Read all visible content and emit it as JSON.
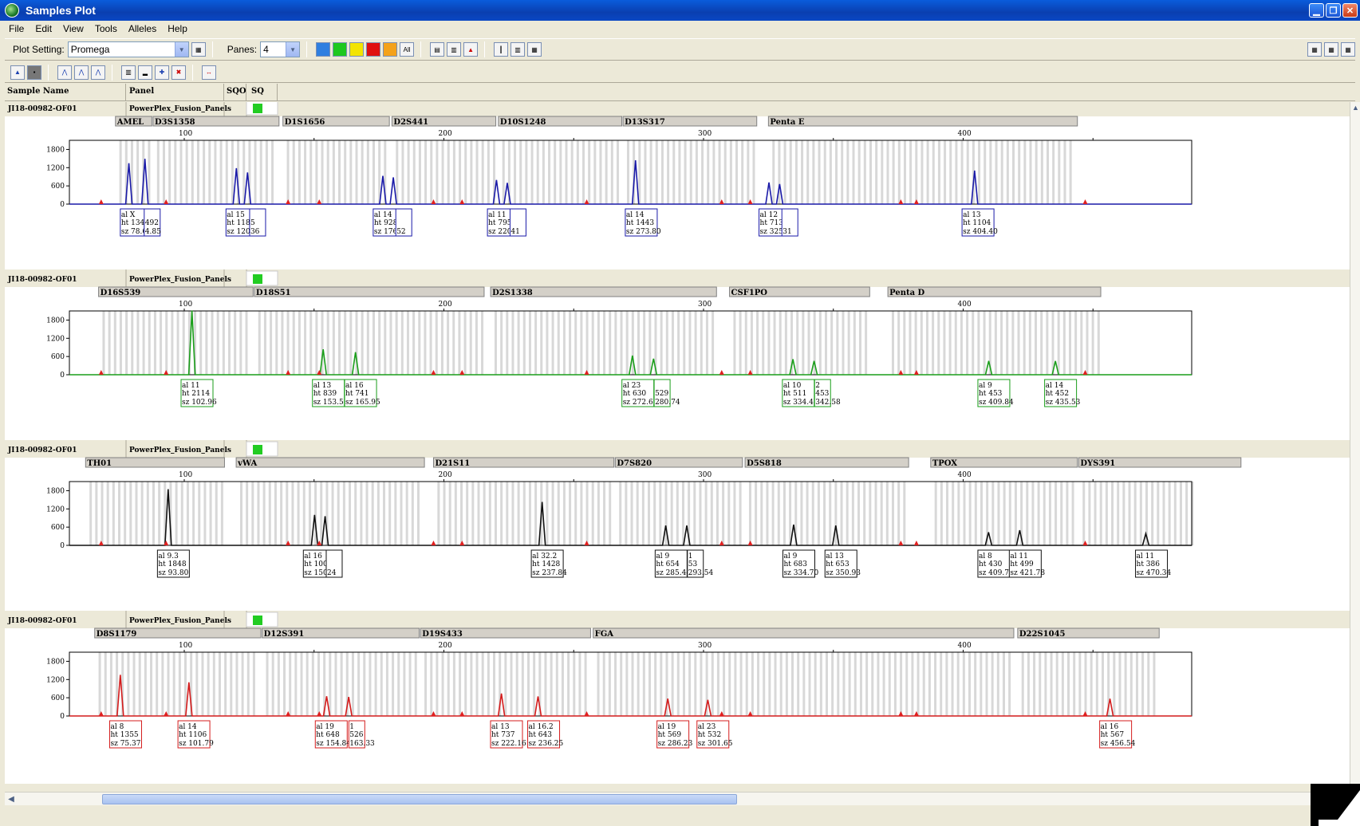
{
  "window": {
    "title": "Samples Plot"
  },
  "menu": [
    "File",
    "Edit",
    "View",
    "Tools",
    "Alleles",
    "Help"
  ],
  "toolbar": {
    "plot_setting_label": "Plot Setting:",
    "plot_setting_value": "Promega",
    "panes_label": "Panes:",
    "panes_value": "4",
    "color_buttons": [
      "#2f7fe0",
      "#1ec81e",
      "#f3e400",
      "#e01010",
      "#f4a21a"
    ],
    "all_label": "All"
  },
  "columns": {
    "sample_name": "Sample Name",
    "panel": "Panel",
    "sqo": "SQO",
    "sq": "SQ"
  },
  "x_ticks": [
    100,
    200,
    300,
    400
  ],
  "y_ticks": [
    0,
    600,
    1200,
    1800
  ],
  "panes": [
    {
      "sample": "JI18-00982-OF01",
      "panel": "PowerPlex_Fusion_Panels",
      "sq_color": "#22cc22",
      "color": "#1a1aa8",
      "loci": [
        {
          "name": "AMEL",
          "start": 73.5,
          "end": 87.5
        },
        {
          "name": "D3S1358",
          "start": 88,
          "end": 136.5
        },
        {
          "name": "D1S1656",
          "start": 138,
          "end": 179
        },
        {
          "name": "D2S441",
          "start": 180,
          "end": 220
        },
        {
          "name": "D10S1248",
          "start": 221,
          "end": 268.5
        },
        {
          "name": "D13S317",
          "start": 269,
          "end": 320.5
        },
        {
          "name": "Penta E",
          "start": 325,
          "end": 444
        }
      ],
      "peaks": [
        {
          "x": 78.67,
          "ht": 1348
        },
        {
          "x": 84.85,
          "ht": 1492
        },
        {
          "x": 120.07,
          "ht": 1182
        },
        {
          "x": 124.36,
          "ht": 1040
        },
        {
          "x": 176.49,
          "ht": 928
        },
        {
          "x": 180.52,
          "ht": 880
        },
        {
          "x": 220.25,
          "ht": 795
        },
        {
          "x": 224.41,
          "ht": 700
        },
        {
          "x": 273.8,
          "ht": 1443
        },
        {
          "x": 325.2,
          "ht": 713
        },
        {
          "x": 329.31,
          "ht": 660
        },
        {
          "x": 404.4,
          "ht": 1104
        }
      ],
      "labels": [
        {
          "x": 80.9,
          "al": "al X",
          "ht": "ht 1348",
          "sz": "sz 78.67"
        },
        {
          "x": 85.5,
          "al": "",
          "ht": "492",
          "sz": "4.85",
          "narrow": true
        },
        {
          "x": 121.6,
          "al": "al 15",
          "ht": "ht 1182",
          "sz": "sz 120.07"
        },
        {
          "x": 126.1,
          "al": "",
          "ht": "5",
          "sz": "36",
          "narrow": true
        },
        {
          "x": 178.3,
          "al": "al 14",
          "ht": "ht 928",
          "sz": "sz 176.49"
        },
        {
          "x": 182.4,
          "al": "",
          "ht": "",
          "sz": "52",
          "narrow": true
        },
        {
          "x": 222.3,
          "al": "al 11",
          "ht": "ht 795",
          "sz": "sz 220.25"
        },
        {
          "x": 226.4,
          "al": "",
          "ht": "",
          "sz": "41",
          "narrow": true
        },
        {
          "x": 275.4,
          "al": "al 14",
          "ht": "ht 1443",
          "sz": "sz 273.80"
        },
        {
          "x": 326.9,
          "al": "al 12",
          "ht": "ht 713",
          "sz": "sz 325.20"
        },
        {
          "x": 331.1,
          "al": "",
          "ht": "",
          "sz": "31",
          "narrow": true
        },
        {
          "x": 405.1,
          "al": "al 13",
          "ht": "ht 1104",
          "sz": "sz 404.40"
        }
      ]
    },
    {
      "sample": "JI18-00982-OF01",
      "panel": "PowerPlex_Fusion_Panels",
      "sq_color": "#22cc22",
      "color": "#1a9e1a",
      "loci": [
        {
          "name": "D16S539",
          "start": 67,
          "end": 126.5
        },
        {
          "name": "D18S51",
          "start": 127,
          "end": 215.5
        },
        {
          "name": "D2S1338",
          "start": 218,
          "end": 305
        },
        {
          "name": "CSF1PO",
          "start": 310,
          "end": 364
        },
        {
          "name": "Penta D",
          "start": 371,
          "end": 453
        }
      ],
      "peaks": [
        {
          "x": 102.96,
          "ht": 2114
        },
        {
          "x": 153.51,
          "ht": 839
        },
        {
          "x": 165.95,
          "ht": 741
        },
        {
          "x": 272.61,
          "ht": 630
        },
        {
          "x": 280.74,
          "ht": 529
        },
        {
          "x": 334.43,
          "ht": 511
        },
        {
          "x": 342.58,
          "ht": 453
        },
        {
          "x": 409.84,
          "ht": 453
        },
        {
          "x": 435.53,
          "ht": 452
        }
      ],
      "labels": [
        {
          "x": 104.3,
          "al": "al 11",
          "ht": "ht 2114",
          "sz": "sz 102.96"
        },
        {
          "x": 154.9,
          "al": "al 13",
          "ht": "ht 839",
          "sz": "sz 153.51"
        },
        {
          "x": 167.3,
          "al": "al 16",
          "ht": "ht 741",
          "sz": "sz 165.95"
        },
        {
          "x": 274.1,
          "al": "al 23",
          "ht": "ht 630",
          "sz": "sz 272.61"
        },
        {
          "x": 281.9,
          "al": "",
          "ht": "529",
          "sz": "280.74",
          "narrow": true
        },
        {
          "x": 335.9,
          "al": "al 10",
          "ht": "ht 511",
          "sz": "sz 334.43"
        },
        {
          "x": 343.7,
          "al": "2",
          "ht": "453",
          "sz": "342.58",
          "narrow": true
        },
        {
          "x": 411.2,
          "al": "al 9",
          "ht": "ht 453",
          "sz": "sz 409.84"
        },
        {
          "x": 436.9,
          "al": "al 14",
          "ht": "ht 452",
          "sz": "sz 435.53"
        }
      ]
    },
    {
      "sample": "JI18-00982-OF01",
      "panel": "PowerPlex_Fusion_Panels",
      "sq_color": "#22cc22",
      "color": "#101010",
      "loci": [
        {
          "name": "TH01",
          "start": 62,
          "end": 115.5
        },
        {
          "name": "vWA",
          "start": 120,
          "end": 192.5
        },
        {
          "name": "D21S11",
          "start": 196,
          "end": 265.5
        },
        {
          "name": "D7S820",
          "start": 266,
          "end": 315
        },
        {
          "name": "D5S818",
          "start": 316,
          "end": 379
        },
        {
          "name": "TPOX",
          "start": 387.5,
          "end": 444
        },
        {
          "name": "DYS391",
          "start": 444.5,
          "end": 507
        }
      ],
      "peaks": [
        {
          "x": 93.8,
          "ht": 1848
        },
        {
          "x": 150.19,
          "ht": 1003
        },
        {
          "x": 154.24,
          "ht": 960
        },
        {
          "x": 237.84,
          "ht": 1428
        },
        {
          "x": 285.44,
          "ht": 654
        },
        {
          "x": 293.54,
          "ht": 653
        },
        {
          "x": 334.7,
          "ht": 683
        },
        {
          "x": 350.93,
          "ht": 653
        },
        {
          "x": 409.77,
          "ht": 430
        },
        {
          "x": 421.78,
          "ht": 499
        },
        {
          "x": 470.34,
          "ht": 386
        }
      ],
      "labels": [
        {
          "x": 95.2,
          "al": "al 9.3",
          "ht": "ht 1848",
          "sz": "sz 93.80"
        },
        {
          "x": 151.4,
          "al": "al 16",
          "ht": "ht 1003",
          "sz": "sz 150.19"
        },
        {
          "x": 155.6,
          "al": "",
          "ht": "",
          "sz": "24",
          "narrow": true
        },
        {
          "x": 239.2,
          "al": "al 32.2",
          "ht": "ht 1428",
          "sz": "sz 237.84"
        },
        {
          "x": 286.9,
          "al": "al 9",
          "ht": "ht 654",
          "sz": "sz 285.44"
        },
        {
          "x": 294.7,
          "al": "1",
          "ht": "53",
          "sz": "293.54",
          "narrow": true
        },
        {
          "x": 336.1,
          "al": "al 9",
          "ht": "ht 683",
          "sz": "sz 334.70"
        },
        {
          "x": 352.3,
          "al": "al 13",
          "ht": "ht 653",
          "sz": "sz 350.93"
        },
        {
          "x": 411.2,
          "al": "al 8",
          "ht": "ht 430",
          "sz": "sz 409.77"
        },
        {
          "x": 423.3,
          "al": "al 11",
          "ht": "ht 499",
          "sz": "sz 421.78"
        },
        {
          "x": 471.9,
          "al": "al 11",
          "ht": "ht 386",
          "sz": "sz 470.34"
        }
      ]
    },
    {
      "sample": "JI18-00982-OF01",
      "panel": "PowerPlex_Fusion_Panels",
      "sq_color": "#22cc22",
      "color": "#d41c1c",
      "loci": [
        {
          "name": "D8S1179",
          "start": 65.5,
          "end": 129.5
        },
        {
          "name": "D12S391",
          "start": 130,
          "end": 190.5
        },
        {
          "name": "D19S433",
          "start": 191,
          "end": 256.5
        },
        {
          "name": "FGA",
          "start": 257.5,
          "end": 419.5
        },
        {
          "name": "D22S1045",
          "start": 421,
          "end": 475.5
        }
      ],
      "peaks": [
        {
          "x": 75.37,
          "ht": 1355
        },
        {
          "x": 101.79,
          "ht": 1106
        },
        {
          "x": 154.84,
          "ht": 648
        },
        {
          "x": 163.33,
          "ht": 626
        },
        {
          "x": 222.16,
          "ht": 737
        },
        {
          "x": 236.25,
          "ht": 643
        },
        {
          "x": 286.23,
          "ht": 569
        },
        {
          "x": 301.65,
          "ht": 532
        },
        {
          "x": 456.54,
          "ht": 567
        }
      ],
      "labels": [
        {
          "x": 76.8,
          "al": "al 8",
          "ht": "ht 1355",
          "sz": "sz 75.37"
        },
        {
          "x": 103.1,
          "al": "al 14",
          "ht": "ht 1106",
          "sz": "sz 101.79"
        },
        {
          "x": 156.0,
          "al": "al 19",
          "ht": "ht 648",
          "sz": "sz 154.84"
        },
        {
          "x": 164.3,
          "al": "1",
          "ht": "526",
          "sz": "163.33",
          "narrow": true
        },
        {
          "x": 223.5,
          "al": "al 13",
          "ht": "ht 737",
          "sz": "sz 222.16"
        },
        {
          "x": 237.8,
          "al": "al 16.2",
          "ht": "ht 643",
          "sz": "sz 236.25"
        },
        {
          "x": 287.6,
          "al": "al 19",
          "ht": "ht 569",
          "sz": "sz 286.23"
        },
        {
          "x": 303.0,
          "al": "al 23",
          "ht": "ht 532",
          "sz": "sz 301.65"
        },
        {
          "x": 458.1,
          "al": "al 16",
          "ht": "ht 567",
          "sz": "sz 456.54"
        }
      ]
    }
  ]
}
